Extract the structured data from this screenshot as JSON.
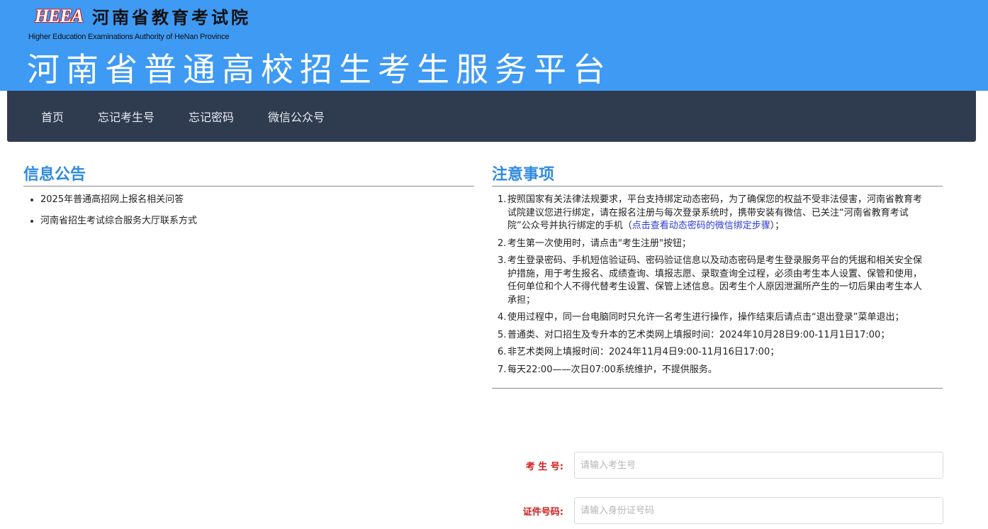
{
  "header": {
    "logo_text": "HEEA",
    "org_name_cn": "河南省教育考试院",
    "org_name_en": "Higher Education Examinations Authority of HeNan Province",
    "platform_title": "河南省普通高校招生考生服务平台"
  },
  "nav": {
    "items": [
      {
        "label": "首页"
      },
      {
        "label": "忘记考生号"
      },
      {
        "label": "忘记密码"
      },
      {
        "label": "微信公众号"
      }
    ]
  },
  "announcements": {
    "title": "信息公告",
    "items": [
      {
        "text": "2025年普通高招网上报名相关问答"
      },
      {
        "text": "河南省招生考试综合服务大厅联系方式"
      }
    ]
  },
  "notices": {
    "title": "注意事项",
    "items": [
      {
        "num": "1.",
        "text": "按照国家有关法律法规要求，平台支持绑定动态密码，为了确保您的权益不受非法侵害，河南省教育考试院建议您进行绑定，请在报名注册与每次登录系统时，携带安装有微信、已关注“河南省教育考试院”公众号并执行绑定的手机（",
        "link": "点击查看动态密码的微信绑定步骤",
        "tail": "）；"
      },
      {
        "num": "2.",
        "text": "考生第一次使用时，请点击\"考生注册\"按钮；"
      },
      {
        "num": "3.",
        "text": "考生登录密码、手机短信验证码、密码验证信息以及动态密码是考生登录服务平台的凭据和相关安全保护措施，用于考生报名、成绩查询、填报志愿、录取查询全过程，必须由考生本人设置、保管和使用，任何单位和个人不得代替考生设置、保管上述信息。因考生个人原因泄漏所产生的一切后果由考生本人承担；"
      },
      {
        "num": "4.",
        "text": "使用过程中，同一台电脑同时只允许一名考生进行操作，操作结束后请点击“退出登录”菜单退出；"
      },
      {
        "num": "5.",
        "text": "普通类、对口招生及专升本的艺术类网上填报时间：2024年10月28日9:00-11月1日17:00；"
      },
      {
        "num": "6.",
        "text": "非艺术类网上填报时间：2024年11月4日9:00-11月16日17:00；"
      },
      {
        "num": "7.",
        "text": "每天22:00——次日07:00系统维护，不提供服务。"
      }
    ]
  },
  "form": {
    "candidate_label": "考 生 号:",
    "candidate_placeholder": "请输入考生号",
    "id_label": "证件号码:",
    "id_placeholder": "请输入身份证号码"
  }
}
